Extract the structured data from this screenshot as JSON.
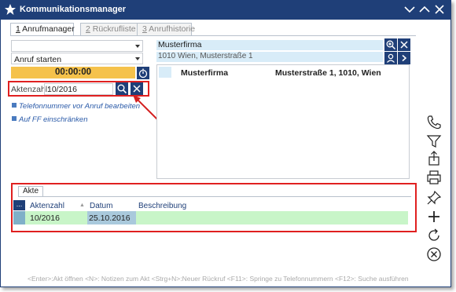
{
  "window": {
    "title": "Kommunikationsmanager"
  },
  "tabs": [
    {
      "num": "1",
      "label": " Anrufmanager"
    },
    {
      "num": "2",
      "label": " Rückrufliste"
    },
    {
      "num": "3",
      "label": " Anrufhistorie"
    }
  ],
  "left": {
    "number_field": "",
    "action_select": "Anruf starten",
    "timer": "00:00:00",
    "aktenzahl_label": "Aktenzahl:",
    "aktenzahl_value": "10/2016",
    "options": [
      "Telefonnummer vor Anruf bearbeiten",
      "Auf FF einschränken"
    ]
  },
  "contact": {
    "name": "Musterfirma",
    "address": "1010 Wien, Musterstraße 1"
  },
  "contact_table": {
    "headers": [
      "Musterfirma",
      "Musterstraße 1, 1010, Wien"
    ]
  },
  "files": {
    "tab": "Akte",
    "grid_button": "...",
    "columns": [
      "Aktenzahl",
      "Datum",
      "Beschreibung"
    ],
    "rows": [
      {
        "aktenzahl": "10/2016",
        "datum": "25.10.2016",
        "beschreibung": ""
      }
    ]
  },
  "statusbar": "<Enter>:Akt öffnen <N>: Notizen zum Akt <Strg+N>:Neuer Rückruf <F11>: Springe zu Telefonnummern <F12>: Suche ausführen",
  "colors": {
    "titlebar": "#1f3f78",
    "timer": "#f5c24b",
    "highlight_box": "#e02020",
    "row": "#c8f5c8"
  }
}
